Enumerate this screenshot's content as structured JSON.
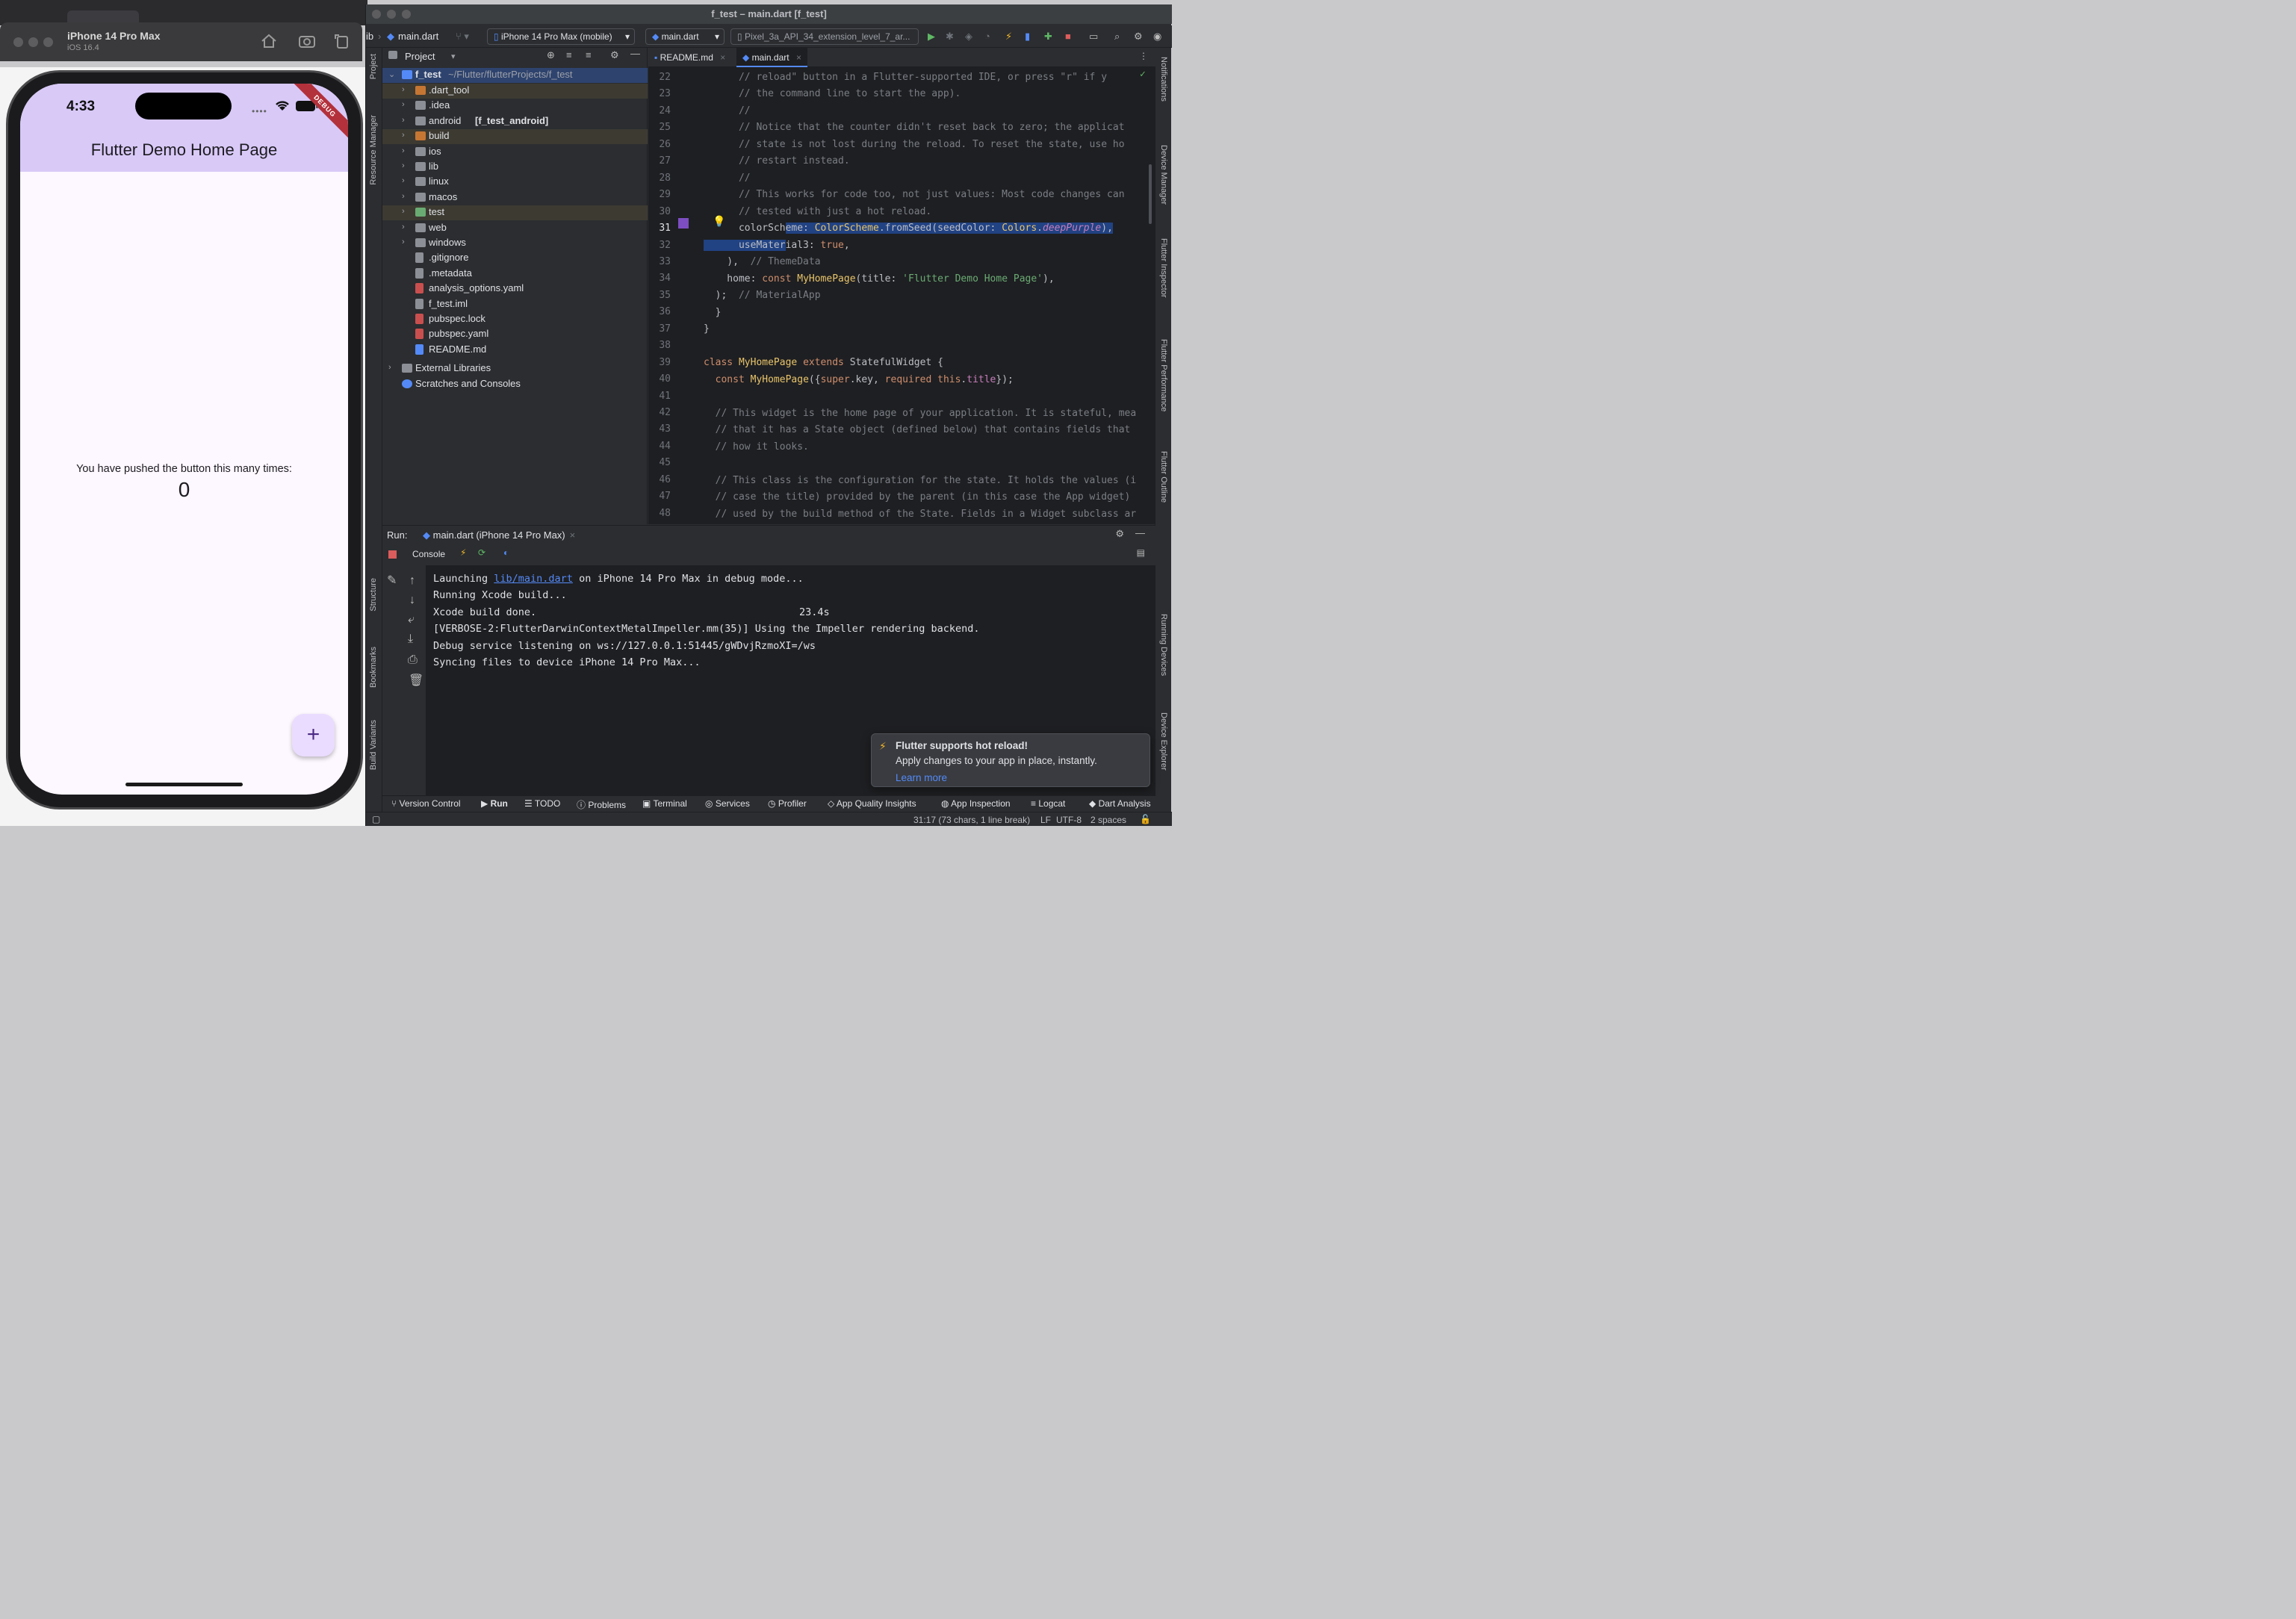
{
  "simulator": {
    "device_name": "iPhone 14 Pro Max",
    "os_version": "iOS 16.4",
    "status_time": "4:33",
    "debug_banner": "DEBUG",
    "app_title": "Flutter Demo Home Page",
    "counter_label": "You have pushed the button this many times:",
    "counter_value": "0",
    "fab_label": "+"
  },
  "ide": {
    "window_title": "f_test – main.dart [f_test]",
    "breadcrumb_lib": "ib",
    "breadcrumb_file": "main.dart",
    "device_selector": "iPhone 14 Pro Max (mobile)",
    "run_config": "main.dart",
    "emulator_selector": "Pixel_3a_API_34_extension_level_7_ar...",
    "left_tools": [
      "Project",
      "Resource Manager",
      "Structure",
      "Bookmarks",
      "Build Variants"
    ],
    "right_tools": [
      "Notifications",
      "Device Manager",
      "Flutter Inspector",
      "Flutter Performance",
      "Flutter Outline",
      "Running Devices",
      "Device Explorer"
    ]
  },
  "project_panel": {
    "header": "Project",
    "root_name": "f_test",
    "root_path": "~/Flutter/flutterProjects/f_test",
    "items": [
      {
        "name": ".dart_tool",
        "kind": "folder",
        "color": "#c57633",
        "expandable": true,
        "highlight": true
      },
      {
        "name": ".idea",
        "kind": "folder",
        "color": "#8c8f96",
        "expandable": true
      },
      {
        "name": "android",
        "suffix": "[f_test_android]",
        "kind": "folder",
        "color": "#8c8f96",
        "expandable": true
      },
      {
        "name": "build",
        "kind": "folder",
        "color": "#c57633",
        "expandable": true,
        "highlight": true
      },
      {
        "name": "ios",
        "kind": "folder",
        "color": "#8c8f96",
        "expandable": true
      },
      {
        "name": "lib",
        "kind": "folder",
        "color": "#8c8f96",
        "expandable": true
      },
      {
        "name": "linux",
        "kind": "folder",
        "color": "#8c8f96",
        "expandable": true
      },
      {
        "name": "macos",
        "kind": "folder",
        "color": "#8c8f96",
        "expandable": true
      },
      {
        "name": "test",
        "kind": "folder",
        "color": "#6aab73",
        "expandable": true,
        "highlight": true
      },
      {
        "name": "web",
        "kind": "folder",
        "color": "#8c8f96",
        "expandable": true
      },
      {
        "name": "windows",
        "kind": "folder",
        "color": "#8c8f96",
        "expandable": true
      },
      {
        "name": ".gitignore",
        "kind": "file",
        "color": "#8c8f96"
      },
      {
        "name": ".metadata",
        "kind": "file",
        "color": "#8c8f96"
      },
      {
        "name": "analysis_options.yaml",
        "kind": "file",
        "color": "#c94f4f"
      },
      {
        "name": "f_test.iml",
        "kind": "file",
        "color": "#8c8f96"
      },
      {
        "name": "pubspec.lock",
        "kind": "file",
        "color": "#c94f4f"
      },
      {
        "name": "pubspec.yaml",
        "kind": "file",
        "color": "#c94f4f"
      },
      {
        "name": "README.md",
        "kind": "file",
        "color": "#548af7"
      }
    ],
    "external_libraries": "External Libraries",
    "scratches": "Scratches and Consoles"
  },
  "editor": {
    "tabs": [
      {
        "label": "README.md",
        "active": false
      },
      {
        "label": "main.dart",
        "active": true
      }
    ],
    "line_numbers": [
      "22",
      "23",
      "24",
      "25",
      "26",
      "27",
      "28",
      "29",
      "30",
      "31",
      "32",
      "33",
      "34",
      "35",
      "36",
      "37",
      "38",
      "39",
      "40",
      "41",
      "42",
      "43",
      "44",
      "45",
      "46",
      "47",
      "48"
    ],
    "lines": {
      "l22": "      // reload\" button in a Flutter-supported IDE, or press \"r\" if y",
      "l23": "      // the command line to start the app).",
      "l24": "      //",
      "l25": "      // Notice that the counter didn't reset back to zero; the applicat",
      "l26": "      // state is not lost during the reload. To reset the state, use ho",
      "l27": "      // restart instead.",
      "l28": "      //",
      "l29": "      // This works for code too, not just values: Most code changes can",
      "l30": "      // tested with just a hot reload.",
      "l31a": "      colorSch",
      "l31b": "eme: ",
      "l31c": "ColorScheme",
      "l31d": ".fromSeed(seedColor: ",
      "l31e": "Colors",
      "l31f": ".",
      "l31g": "deepPurple",
      "l31h": "),",
      "l32a": "      useMater",
      "l32b": "ial3: ",
      "l32c": "true",
      "l32d": ",",
      "l33a": "    ),",
      "l33b": "  // ThemeData",
      "l34a": "    home: ",
      "l34b": "const ",
      "l34c": "MyHomePage",
      "l34d": "(title: ",
      "l34e": "'Flutter Demo Home Page'",
      "l34f": "),",
      "l35a": "  );",
      "l35b": "  // MaterialApp",
      "l36": "  }",
      "l37": "}",
      "l39a": "class ",
      "l39b": "MyHomePage ",
      "l39c": "extends ",
      "l39d": "StatefulWidget {",
      "l40a": "  const ",
      "l40b": "MyHomePage",
      "l40c": "({",
      "l40d": "super",
      "l40e": ".key, ",
      "l40f": "required this",
      "l40g": ".",
      "l40h": "title",
      "l40i": "});",
      "l42": "  // This widget is the home page of your application. It is stateful, mea",
      "l43": "  // that it has a State object (defined below) that contains fields that",
      "l44": "  // how it looks.",
      "l46": "  // This class is the configuration for the state. It holds the values (i",
      "l47": "  // case the title) provided by the parent (in this case the App widget)",
      "l48": "  // used by the build method of the State. Fields in a Widget subclass ar"
    }
  },
  "run_panel": {
    "label": "Run:",
    "config_tab": "main.dart (iPhone 14 Pro Max)",
    "console_tab": "Console",
    "lines": {
      "c1a": "Launching ",
      "c1b": "lib/main.dart",
      "c1c": " on iPhone 14 Pro Max in debug mode...",
      "c2": "Running Xcode build...",
      "c3a": "Xcode build done.",
      "c3b": "23.4s",
      "c4": "[VERBOSE-2:FlutterDarwinContextMetalImpeller.mm(35)] Using the Impeller rendering backend.",
      "c5": "Debug service listening on ws://127.0.0.1:51445/gWDvjRzmoXI=/ws",
      "c6": "Syncing files to device iPhone 14 Pro Max..."
    }
  },
  "notification": {
    "title": "Flutter supports hot reload!",
    "body": "Apply changes to your app in place, instantly.",
    "link": "Learn more"
  },
  "bottom_tools": [
    "Version Control",
    "Run",
    "TODO",
    "Problems",
    "Terminal",
    "Services",
    "Profiler",
    "App Quality Insights",
    "App Inspection",
    "Logcat",
    "Dart Analysis"
  ],
  "status_bar": {
    "position": "31:17 (73 chars, 1 line break)",
    "line_ending": "LF",
    "encoding": "UTF-8",
    "indent": "2 spaces"
  },
  "colors": {
    "app_bar": "#d8c9f7",
    "fab": "#eadcff",
    "selection": "#214283",
    "debug_banner": "#b3313b"
  }
}
